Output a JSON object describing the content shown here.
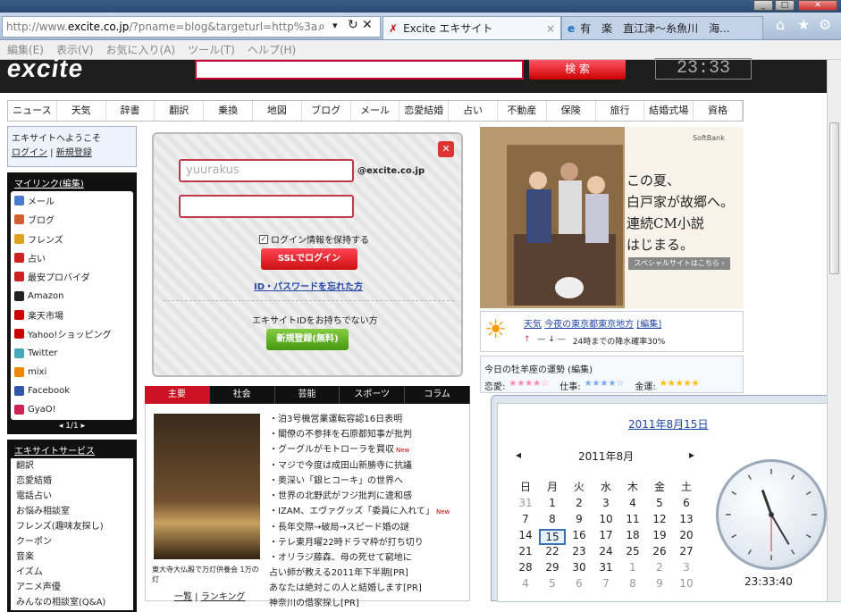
{
  "browser": {
    "url_prefix": "http://www.",
    "url_host": "excite.co.jp",
    "url_rest": "/?pname=blog&targeturl=http%3a",
    "search_icon": "search-icon",
    "tabs": [
      {
        "title": "Excite エキサイト",
        "close": "×"
      },
      {
        "title": "有　楽　直江津〜糸魚川　海..."
      }
    ],
    "menu": [
      "編集(E)",
      "表示(V)",
      "お気に入り(A)",
      "ツール(T)",
      "ヘルプ(H)"
    ]
  },
  "header": {
    "logo": "excite",
    "search_btn": "検 索",
    "clock": "23:33"
  },
  "nav": [
    "ニュース",
    "天気",
    "辞書",
    "翻訳",
    "乗換",
    "地図",
    "ブログ",
    "メール",
    "恋愛結婚",
    "占い",
    "不動産",
    "保険",
    "旅行",
    "結婚式場",
    "資格"
  ],
  "welcome": {
    "line1": "エキサイトへようこそ",
    "login": "ログイン",
    "register": "新規登録"
  },
  "mylinks": {
    "title": "マイリンク(編集)",
    "items": [
      {
        "label": "メール",
        "icon": "mail-icon",
        "color": "#4a7bd0"
      },
      {
        "label": "ブログ",
        "icon": "blog-icon",
        "color": "#d06030"
      },
      {
        "label": "フレンズ",
        "icon": "friends-icon",
        "color": "#e0a020"
      },
      {
        "label": "占い",
        "icon": "fortune-icon",
        "color": "#cc2222"
      },
      {
        "label": "最安プロバイダ",
        "icon": "provider-icon",
        "color": "#cc2222"
      },
      {
        "label": "Amazon",
        "icon": "amazon-icon",
        "color": "#222"
      },
      {
        "label": "楽天市場",
        "icon": "rakuten-icon",
        "color": "#c00"
      },
      {
        "label": "Yahoo!ショッピング",
        "icon": "yahoo-icon",
        "color": "#c00"
      },
      {
        "label": "Twitter",
        "icon": "twitter-icon",
        "color": "#4ab"
      },
      {
        "label": "mixi",
        "icon": "mixi-icon",
        "color": "#e80"
      },
      {
        "label": "Facebook",
        "icon": "facebook-icon",
        "color": "#35a"
      },
      {
        "label": "GyaO!",
        "icon": "gyao-icon",
        "color": "#c25"
      }
    ],
    "pager": "1/1"
  },
  "services": {
    "title": "エキサイトサービス",
    "items": [
      "翻訳",
      "恋愛結婚",
      "電話占い",
      "お悩み相談室",
      "フレンズ(趣味友探し)",
      "クーポン",
      "音楽",
      "イズム",
      "アニメ声優",
      "みんなの相談室(Q&A)"
    ]
  },
  "login": {
    "username": "yuurakus",
    "domain": "@excite.co.jp",
    "keep": "ログイン情報を保持する",
    "ssl_btn": "SSLでログイン",
    "forgot": "ID・パスワードを忘れた方",
    "no_id": "エキサイトIDをお持ちでない方",
    "register_btn": "新規登録(無料)"
  },
  "ad": {
    "brand": "SoftBank",
    "line1": "この夏、",
    "line2": "白戸家が故郷へ。",
    "line3": "連続CM小説",
    "line4": "はじまる。",
    "link": "スペシャルサイトはこちら ›"
  },
  "weather": {
    "title": "天気",
    "place": "今夜の東京都東京地方",
    "edit": "[編集]",
    "temps": "— ↓ —",
    "rain": "24時までの降水確率30%"
  },
  "horoscope": {
    "title": "今日の牡羊座の運勢 (編集)",
    "love": "恋愛:",
    "work": "仕事:",
    "money": "金運:"
  },
  "newstabs": [
    "主要",
    "社会",
    "芸能",
    "スポーツ",
    "コラム"
  ],
  "news": {
    "caption": "東大寺大仏殿で万灯供養会 1万の灯",
    "list_link": "一覧",
    "rank_link": "ランキング",
    "items": [
      "・泊3号機営業運転容認16日表明",
      "・閣僚の不参拝を石原都知事が批判",
      "・グーグルがモトローラを買収",
      "・マジで今度は成田山新勝寺に抗議",
      "・奥深い「銀ヒコーキ」の世界へ",
      "・世界の北野武がフジ批判に違和感",
      "・IZAM、エヴァグッズ「委員に入れて」",
      "・長年交際→破局→スピード婚の謎",
      "・テレ東月曜22時ドラマ枠が打ち切り",
      "・オリラジ藤森、母の死せて窮地に",
      "占い師が教える2011年下半期[PR]",
      "あなたは絶対この人と結婚します[PR]",
      "神奈川の借家探し[PR]"
    ],
    "new_badge": "New"
  },
  "calendar": {
    "date_link": "2011年8月15日",
    "month": "2011年8月",
    "prev": "◂",
    "next": "▸",
    "weekdays": [
      "日",
      "月",
      "火",
      "水",
      "木",
      "金",
      "土"
    ],
    "rows": [
      [
        "31",
        "1",
        "2",
        "3",
        "4",
        "5",
        "6"
      ],
      [
        "7",
        "8",
        "9",
        "10",
        "11",
        "12",
        "13"
      ],
      [
        "14",
        "15",
        "16",
        "17",
        "18",
        "19",
        "20"
      ],
      [
        "21",
        "22",
        "23",
        "24",
        "25",
        "26",
        "27"
      ],
      [
        "28",
        "29",
        "30",
        "31",
        "1",
        "2",
        "3"
      ],
      [
        "4",
        "5",
        "6",
        "7",
        "8",
        "9",
        "10"
      ]
    ],
    "time": "23:33:40"
  }
}
